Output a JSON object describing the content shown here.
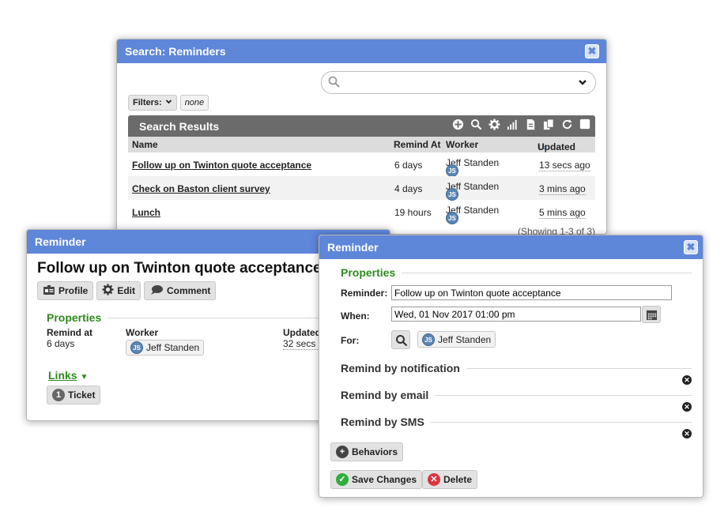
{
  "search_window": {
    "title": "Search: Reminders",
    "close_glyph": "✖",
    "search_placeholder": "",
    "filters_label": "Filters:",
    "filters_value": "none",
    "results_title": "Search Results",
    "columns": {
      "name": "Name",
      "remind_at": "Remind At",
      "worker": "Worker",
      "updated": "Updated"
    },
    "rows": [
      {
        "name": "Follow up on Twinton quote acceptance",
        "remind_at": "6 days",
        "worker": "Jeff Standen",
        "updated": "13 secs ago"
      },
      {
        "name": "Check on Baston client survey",
        "remind_at": "4 days",
        "worker": "Jeff Standen",
        "updated": "3 mins ago"
      },
      {
        "name": "Lunch",
        "remind_at": "19 hours",
        "worker": "Jeff Standen",
        "updated": "5 mins ago"
      }
    ],
    "showing": "(Showing 1-3 of 3)"
  },
  "reminder_card": {
    "title": "Reminder",
    "heading": "Follow up on Twinton quote acceptance",
    "buttons": {
      "profile": "Profile",
      "edit": "Edit",
      "comment": "Comment"
    },
    "properties_label": "Properties",
    "remind_at_label": "Remind at",
    "remind_at_value": "6 days",
    "worker_label": "Worker",
    "worker_value": "Jeff Standen",
    "updated_label": "Updated",
    "updated_value": "32 secs",
    "links_label": "Links",
    "ticket_count": "1",
    "ticket_label": "Ticket"
  },
  "reminder_editor": {
    "title": "Reminder",
    "close_glyph": "✖",
    "properties_label": "Properties",
    "reminder_label": "Reminder:",
    "reminder_value": "Follow up on Twinton quote acceptance",
    "when_label": "When:",
    "when_value": "Wed, 01 Nov 2017 01:00 pm",
    "for_label": "For:",
    "for_value": "Jeff Standen",
    "remind_notification": "Remind by notification",
    "remind_email": "Remind by email",
    "remind_sms": "Remind by SMS",
    "behaviors_label": "Behaviors",
    "save_label": "Save Changes",
    "delete_label": "Delete"
  },
  "avatar_initials": "JS",
  "colors": {
    "titlebar": "#5e86d9",
    "section_green": "#2f8a1e",
    "save_green": "#2fae3e",
    "delete_red": "#d9363e"
  }
}
